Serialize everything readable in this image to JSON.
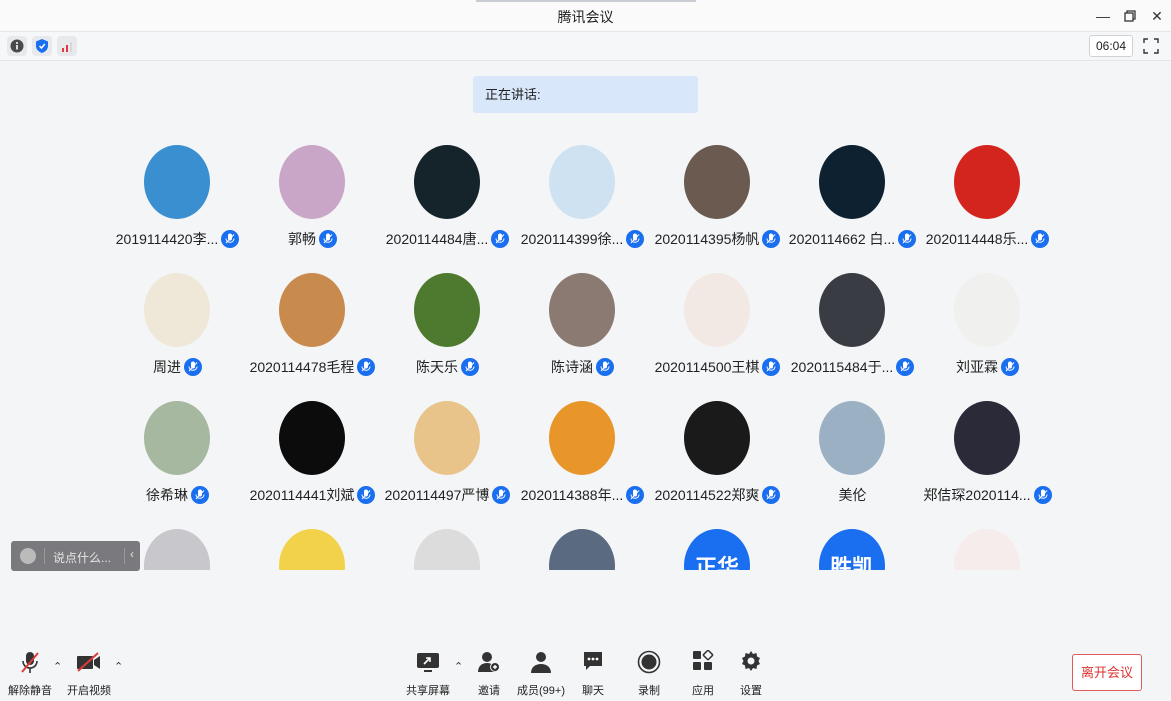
{
  "window": {
    "title": "腾讯会议"
  },
  "toolbar": {
    "timer": "06:04"
  },
  "speaking_label": "正在讲话:",
  "participants": [
    {
      "name": "2019114420李...",
      "avatar_color": "#3a8fd0"
    },
    {
      "name": "郭畅",
      "avatar_color": "#c9a6c8"
    },
    {
      "name": "2020114484唐...",
      "avatar_color": "#15242a"
    },
    {
      "name": "2020114399徐...",
      "avatar_color": "#cfe2f2"
    },
    {
      "name": "2020114395杨帆",
      "avatar_color": "#6b5a50"
    },
    {
      "name": "2020114662 白...",
      "avatar_color": "#0e2130"
    },
    {
      "name": "2020114448乐...",
      "avatar_color": "#d4241e"
    },
    {
      "name": "周进",
      "avatar_color": "#efe7d8"
    },
    {
      "name": "2020114478毛程",
      "avatar_color": "#c98a4e"
    },
    {
      "name": "陈天乐",
      "avatar_color": "#4d7a2e"
    },
    {
      "name": "陈诗涵",
      "avatar_color": "#8a7a72"
    },
    {
      "name": "2020114500王棋",
      "avatar_color": "#f2e9e4"
    },
    {
      "name": "2020115484于...",
      "avatar_color": "#3a3c44"
    },
    {
      "name": "刘亚霖",
      "avatar_color": "#f0f0ee"
    },
    {
      "name": "徐希琳",
      "avatar_color": "#a6b8a0"
    },
    {
      "name": "2020114441刘斌",
      "avatar_color": "#0c0c0c"
    },
    {
      "name": "2020114497严博",
      "avatar_color": "#e8c48a"
    },
    {
      "name": "2020114388年...",
      "avatar_color": "#e8952a"
    },
    {
      "name": "2020114522郑爽",
      "avatar_color": "#1a1a1a"
    },
    {
      "name": "美伦",
      "avatar_color": "#9cb0c4"
    },
    {
      "name": "郑佶琛2020114...",
      "avatar_color": "#2a2a38"
    },
    {
      "name": "",
      "avatar_color": "#c8c8cc"
    },
    {
      "name": "",
      "avatar_color": "#f2d24a"
    },
    {
      "name": "",
      "avatar_color": "#dcdcdc"
    },
    {
      "name": "",
      "avatar_color": "#5a6a80"
    },
    {
      "name": "",
      "avatar_color": "#1a6ef0",
      "avatar_text": "正华"
    },
    {
      "name": "",
      "avatar_color": "#1a6ef0",
      "avatar_text": "胜凯"
    },
    {
      "name": "",
      "avatar_color": "#f7ecec"
    }
  ],
  "chat_input": {
    "placeholder": "说点什么..."
  },
  "bottom": {
    "unmute": "解除静音",
    "start_video": "开启视频",
    "share_screen": "共享屏幕",
    "invite": "邀请",
    "members": "成员(99+)",
    "chat": "聊天",
    "record": "录制",
    "apps": "应用",
    "settings": "设置",
    "leave": "离开会议"
  },
  "colors": {
    "accent": "#1a6ef0",
    "leave": "#e05a5a"
  }
}
